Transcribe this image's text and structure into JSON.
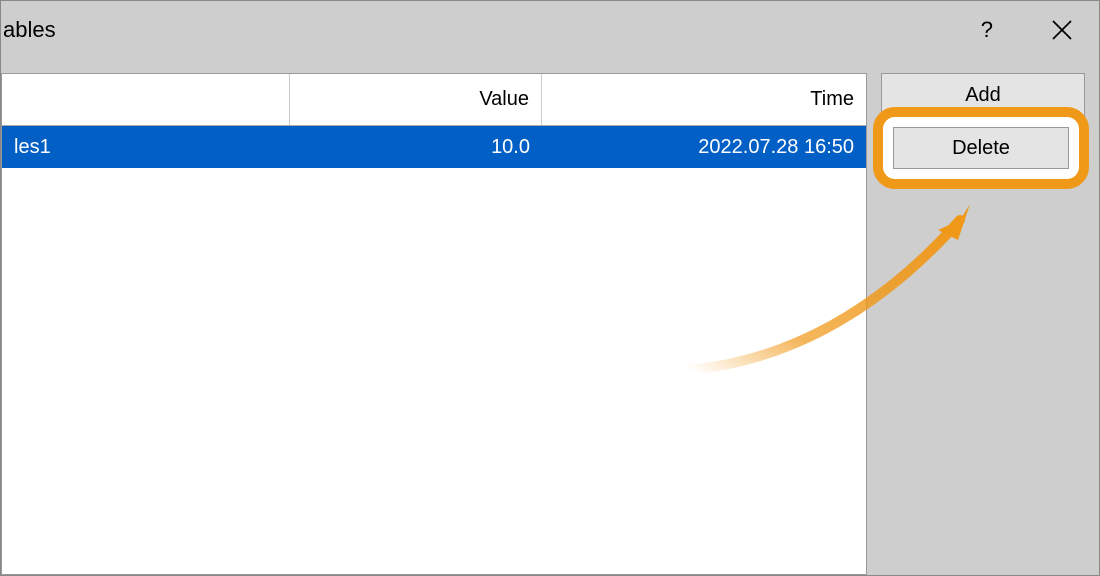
{
  "titlebar": {
    "title": "ables"
  },
  "table": {
    "headers": {
      "name": "",
      "value": "Value",
      "time": "Time"
    },
    "rows": [
      {
        "name": "les1",
        "value": "10.0",
        "time": "2022.07.28 16:50"
      }
    ]
  },
  "sidebar": {
    "add_label": "Add",
    "delete_label": "Delete"
  }
}
